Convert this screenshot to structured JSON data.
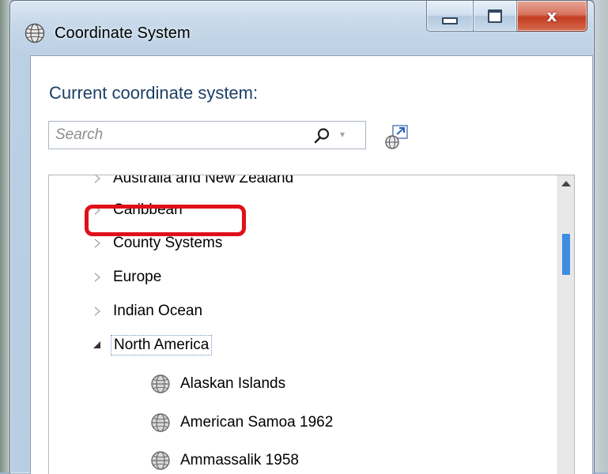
{
  "window": {
    "title": "Coordinate System",
    "minimize_label": "",
    "maximize_label": "",
    "close_label": "x"
  },
  "heading": "Current coordinate system:",
  "search": {
    "placeholder": "Search",
    "value": "",
    "dropdown_glyph": "▾"
  },
  "tree": {
    "items": [
      {
        "label": "Australia and New Zealand",
        "state": "collapsed",
        "level": 0
      },
      {
        "label": "Caribbean",
        "state": "collapsed",
        "level": 0
      },
      {
        "label": "County Systems",
        "state": "collapsed",
        "level": 0
      },
      {
        "label": "Europe",
        "state": "collapsed",
        "level": 0
      },
      {
        "label": "Indian Ocean",
        "state": "collapsed",
        "level": 0
      },
      {
        "label": "North America",
        "state": "expanded",
        "level": 0,
        "selected": true
      },
      {
        "label": "Alaskan Islands",
        "state": "leaf",
        "level": 1,
        "icon": "globe-icon"
      },
      {
        "label": "American Samoa 1962",
        "state": "leaf",
        "level": 1,
        "icon": "globe-icon"
      },
      {
        "label": "Ammassalik 1958",
        "state": "leaf",
        "level": 1,
        "icon": "globe-icon"
      }
    ]
  },
  "colors": {
    "heading": "#1e3f66",
    "highlight_outline": "#e0101a",
    "scroll_thumb": "#3d8ee0"
  },
  "icons": {
    "title": "globe-icon",
    "search": "search-icon",
    "link": "globe-link-icon"
  }
}
